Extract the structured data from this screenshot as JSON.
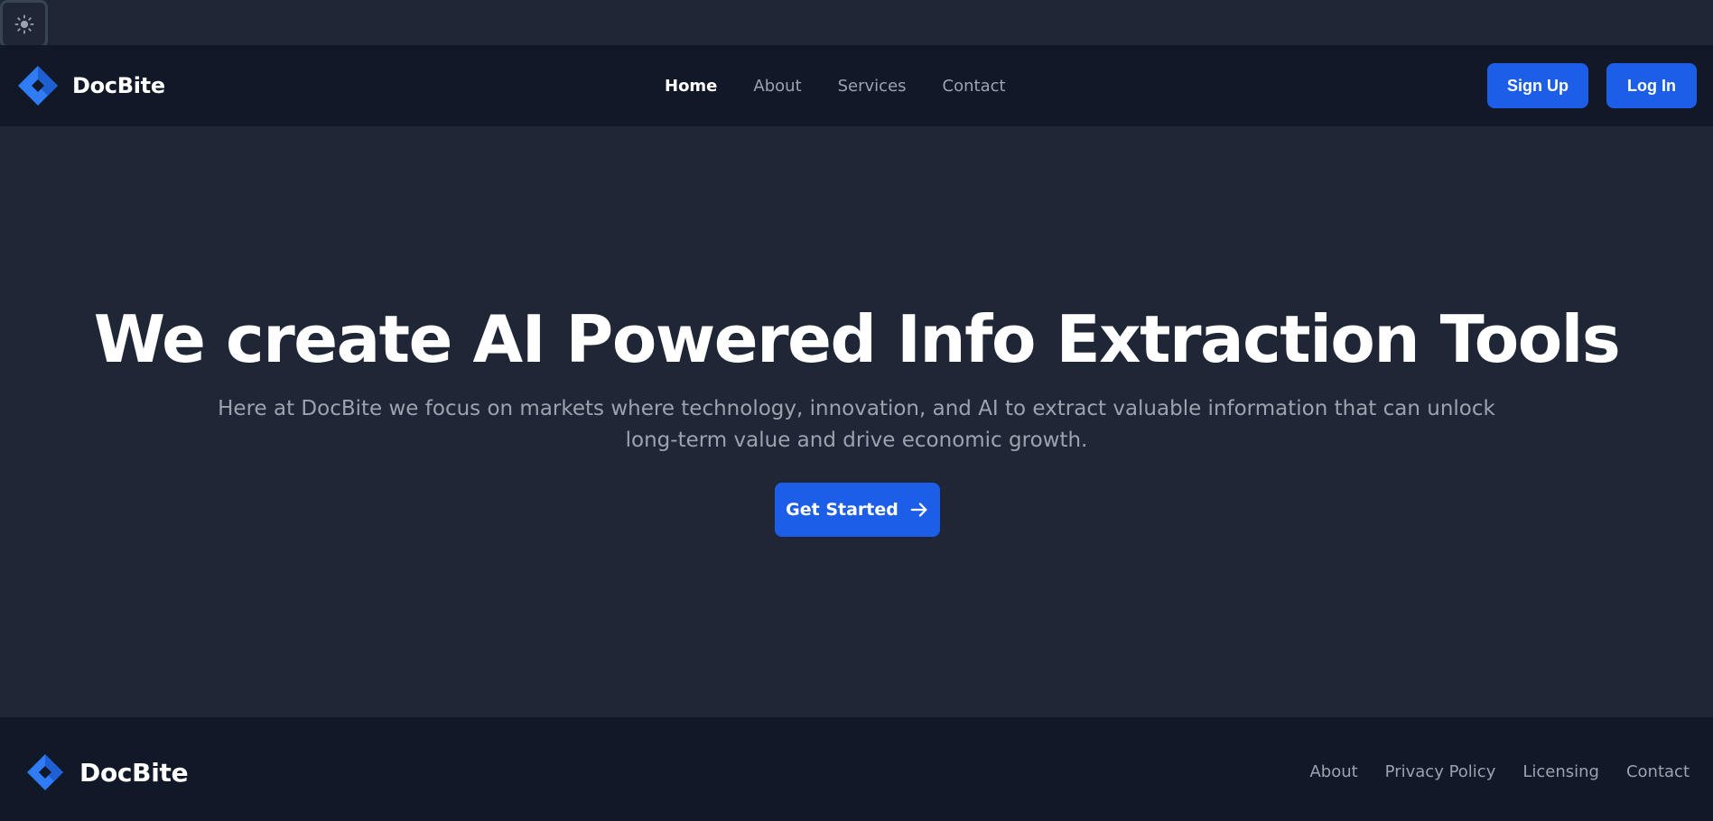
{
  "theme_toggle": {
    "icon": "sun-icon"
  },
  "header": {
    "brand": "DocBite",
    "nav": [
      {
        "label": "Home",
        "active": true
      },
      {
        "label": "About",
        "active": false
      },
      {
        "label": "Services",
        "active": false
      },
      {
        "label": "Contact",
        "active": false
      }
    ],
    "signup_label": "Sign Up",
    "login_label": "Log In"
  },
  "hero": {
    "title": "We create AI Powered Info Extraction Tools",
    "subtitle": "Here at DocBite we focus on markets where technology, innovation, and AI to extract valuable information that can unlock long-term value and drive economic growth.",
    "cta_label": "Get Started",
    "cta_icon": "arrow-right-icon"
  },
  "footer": {
    "brand": "DocBite",
    "links": [
      "About",
      "Privacy Policy",
      "Licensing",
      "Contact"
    ]
  },
  "colors": {
    "background": "#1f2737",
    "navbar": "#111827",
    "accent": "#1d5ee8",
    "logo": "#2f7cf6",
    "muted_text": "#9ca3af"
  }
}
